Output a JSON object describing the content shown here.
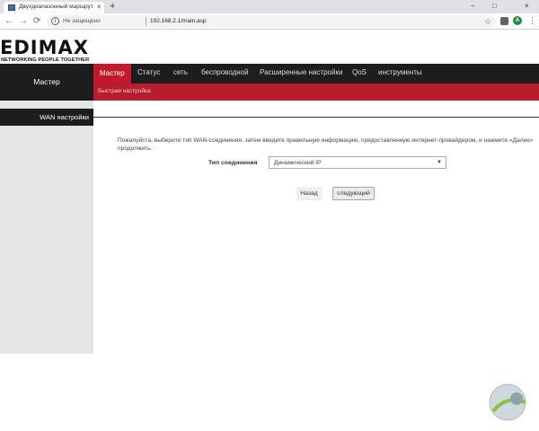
{
  "browser": {
    "tab_title": "Двухдиапазонный маршрутиза",
    "new_tab": "+",
    "tab_close": "×",
    "window_controls": {
      "minimize": "−",
      "maximize": "□",
      "close": "×"
    },
    "nav": {
      "back": "←",
      "forward": "→",
      "reload": "⟳"
    },
    "security_label": "Не защищено",
    "url": "192.168.2.1/main.asp",
    "profile_initial": "A",
    "star": "☆",
    "menu": "⋮"
  },
  "page": {
    "logo": "EDIMAX",
    "logo_tagline": "NETWORKING PEOPLE TOGETHER",
    "left_header": "Мастер",
    "nav_items": [
      {
        "label": "Мастер",
        "active": true
      },
      {
        "label": "Статус"
      },
      {
        "label": "сеть"
      },
      {
        "label": "беспроводной"
      },
      {
        "label": "Расширенные настройки"
      },
      {
        "label": "QoS"
      },
      {
        "label": "инструменты"
      }
    ],
    "subnav": "Быстрая настройка",
    "sidebar_item": "WAN настройки",
    "instruction": "Пожалуйста, выберите тип WAN-соединения, затем введите правильную информацию, предоставленную интернет-провайдером, и нажмите «Далее» продолжить.",
    "connection_label": "Тип соединения",
    "connection_value": "Динамический IP",
    "back_button": "Назад",
    "next_button": "следующий"
  },
  "colors": {
    "accent_red": "#c4192c",
    "nav_dark": "#1d1d1d",
    "sidebar_grey": "#e5e5e5"
  }
}
